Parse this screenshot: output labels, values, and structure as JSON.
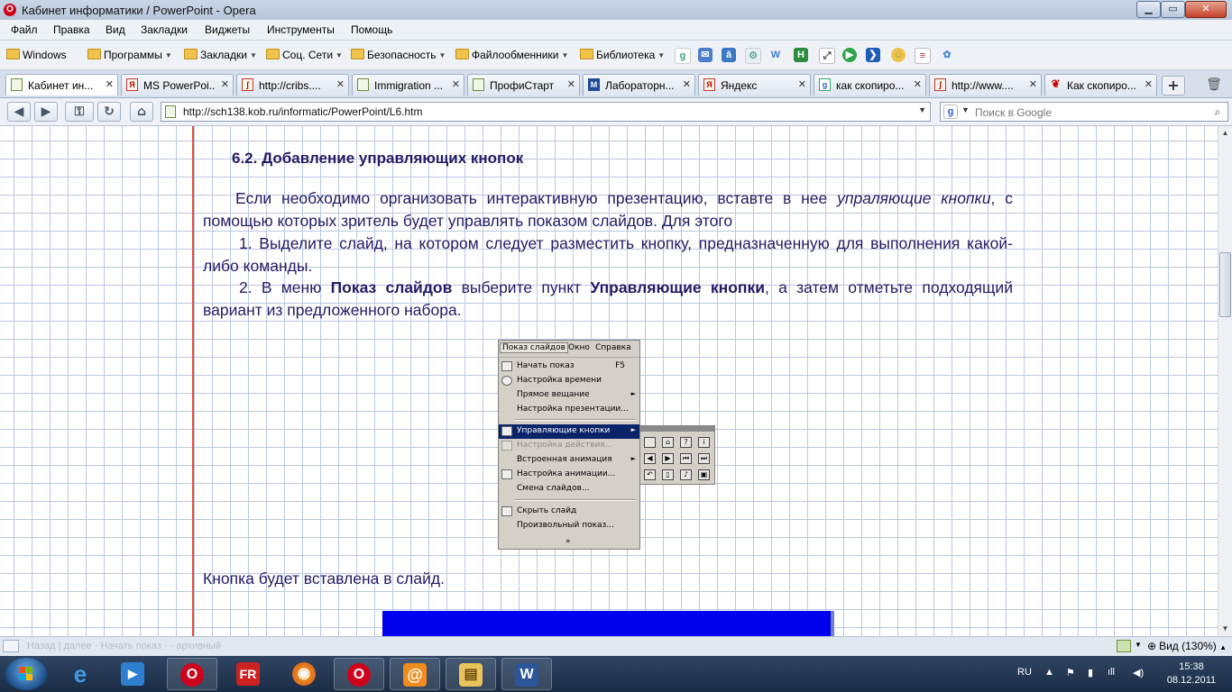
{
  "window": {
    "title": "Кабинет информатики / PowerPoint - Opera",
    "logo_letter": "O"
  },
  "menu": [
    "Файл",
    "Правка",
    "Вид",
    "Закладки",
    "Виджеты",
    "Инструменты",
    "Помощь"
  ],
  "bookmarks": [
    "Windows",
    "Программы",
    "Закладки",
    "Соц. Сети",
    "Безопасность",
    "Файлообменники",
    "Библиотека"
  ],
  "tabs": [
    {
      "label": "Кабинет ин...",
      "active": true
    },
    {
      "label": "MS PowerPoi..."
    },
    {
      "label": "http://cribs...."
    },
    {
      "label": "Immigration ..."
    },
    {
      "label": "ПрофиСтарт"
    },
    {
      "label": "Лабораторн..."
    },
    {
      "label": "Яндекс"
    },
    {
      "label": "как скопиро..."
    },
    {
      "label": "http://www...."
    },
    {
      "label": "Как скопиро..."
    }
  ],
  "address": {
    "url": "http://sch138.kob.ru/informatic/PowerPoint/L6.htm",
    "search_placeholder": "Поиск в Google"
  },
  "article": {
    "heading": "6.2.  Добавление управляющих кнопок",
    "p1_before": "Если необходимо организовать интерактивную презентацию, вставте в нее ",
    "p1_italic": "упраляющие кнопки",
    "p1_after": ", с помощью которых зритель будет управлять показом слайдов. Для этого",
    "p2": "1.  Выделите слайд, на котором следует разместить кнопку, предназначенную для выполнения какой-либо команды.",
    "p3_a": "2.  В меню ",
    "p3_b": "Показ слайдов",
    "p3_c": " выберите пункт ",
    "p3_d": "Управляющие кнопки",
    "p3_e": ", а затем отметьте подходящий вариант из предложенного набора.",
    "caption": "Кнопка будет вставлена в слайд."
  },
  "ppt_menu": {
    "menubar": [
      "Показ слайдов",
      "Окно",
      "Справка"
    ],
    "items": [
      {
        "label": "Начать показ",
        "shortcut": "F5"
      },
      {
        "label": "Настройка времени"
      },
      {
        "label": "Прямое вещание",
        "arrow": "►"
      },
      {
        "label": "Настройка презентации..."
      },
      {
        "label": "Управляющие кнопки",
        "arrow": "►"
      },
      {
        "label": "Настройка действия..."
      },
      {
        "label": "Встроенная анимация",
        "arrow": "►"
      },
      {
        "label": "Настройка анимации..."
      },
      {
        "label": "Смена слайдов..."
      },
      {
        "label": "Скрыть слайд"
      },
      {
        "label": "Произвольный показ..."
      }
    ],
    "more": "»"
  },
  "status": {
    "zoom": "Вид (130%)",
    "ghost": "Назад | далее ·   Начать показ ·   · архивный"
  },
  "tray": {
    "lang": "RU",
    "time": "15:38",
    "date": "08.12.2011"
  }
}
